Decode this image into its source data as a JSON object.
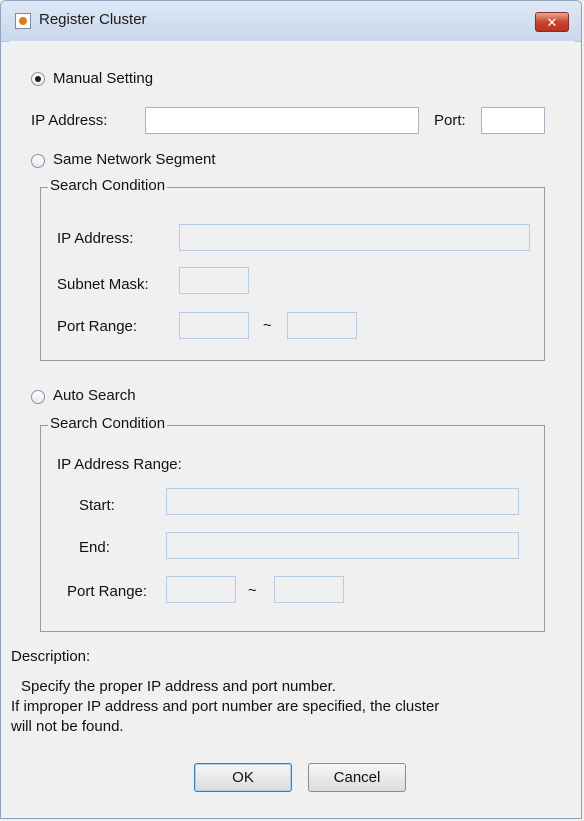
{
  "window": {
    "title": "Register Cluster",
    "close_label": "✕"
  },
  "manual": {
    "label": "Manual Setting",
    "selected": true,
    "ip_label": "IP Address:",
    "ip_value": "",
    "port_label": "Port:",
    "port_value": ""
  },
  "segment": {
    "label": "Same Network Segment",
    "selected": false,
    "group_title": "Search Condition",
    "ip_label": "IP Address:",
    "subnet_label": "Subnet Mask:",
    "port_range_label": "Port Range:",
    "range_sep": "~"
  },
  "auto": {
    "label": "Auto Search",
    "selected": false,
    "group_title": "Search Condition",
    "ip_range_label": "IP Address Range:",
    "start_label": "Start:",
    "end_label": "End:",
    "port_range_label": "Port Range:",
    "range_sep": "~"
  },
  "description": {
    "label": "Description:",
    "line1": "Specify the proper IP address and port number.",
    "line2": "If improper IP address and port number are specified, the cluster",
    "line3": "will not be found."
  },
  "buttons": {
    "ok": "OK",
    "cancel": "Cancel"
  }
}
